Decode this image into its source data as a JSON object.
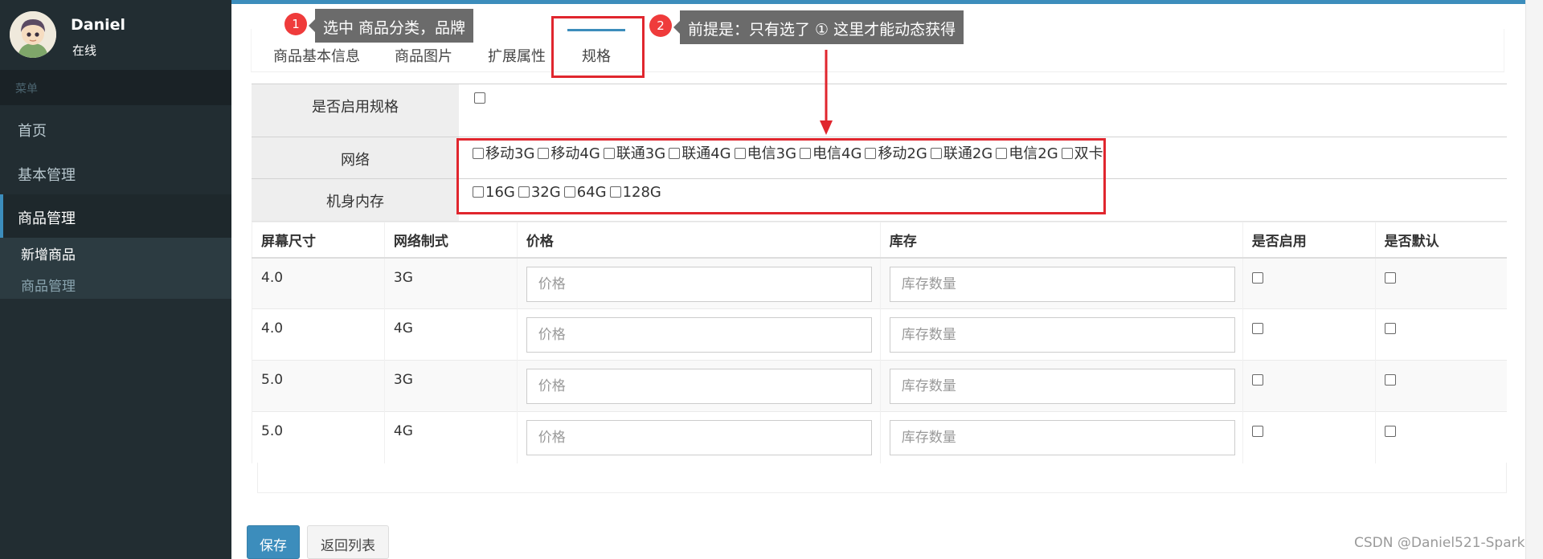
{
  "user": {
    "name": "Daniel",
    "status": "在线"
  },
  "sidebar": {
    "header": "菜单",
    "items": [
      {
        "label": "首页"
      },
      {
        "label": "基本管理"
      },
      {
        "label": "商品管理"
      }
    ],
    "submenu": [
      {
        "label": "新增商品"
      },
      {
        "label": "商品管理"
      }
    ]
  },
  "tabs": [
    {
      "label": "商品基本信息"
    },
    {
      "label": "商品图片"
    },
    {
      "label": "扩展属性"
    },
    {
      "label": "规格"
    }
  ],
  "form": {
    "enable_label": "是否启用规格",
    "network_label": "网络",
    "network_options": [
      "移动3G",
      "移动4G",
      "联通3G",
      "联通4G",
      "电信3G",
      "电信4G",
      "移动2G",
      "联通2G",
      "电信2G",
      "双卡"
    ],
    "memory_label": "机身内存",
    "memory_options": [
      "16G",
      "32G",
      "64G",
      "128G"
    ]
  },
  "table": {
    "headers": [
      "屏幕尺寸",
      "网络制式",
      "价格",
      "库存",
      "是否启用",
      "是否默认"
    ],
    "price_placeholder": "价格",
    "stock_placeholder": "库存数量",
    "rows": [
      {
        "screen": "4.0",
        "network": "3G"
      },
      {
        "screen": "4.0",
        "network": "4G"
      },
      {
        "screen": "5.0",
        "network": "3G"
      },
      {
        "screen": "5.0",
        "network": "4G"
      }
    ]
  },
  "buttons": {
    "save": "保存",
    "back": "返回列表"
  },
  "annotations": {
    "badge1": "1",
    "tip1": "选中 商品分类，品牌",
    "badge2": "2",
    "tip2": "前提是：只有选了 ① 这里才能动态获得"
  },
  "watermark": "CSDN @Daniel521-Spark",
  "colors": {
    "accent": "#3c8dbc",
    "sidebar": "#222d32",
    "annotation_red": "#e0262e",
    "tooltip": "#6b6b6b"
  }
}
